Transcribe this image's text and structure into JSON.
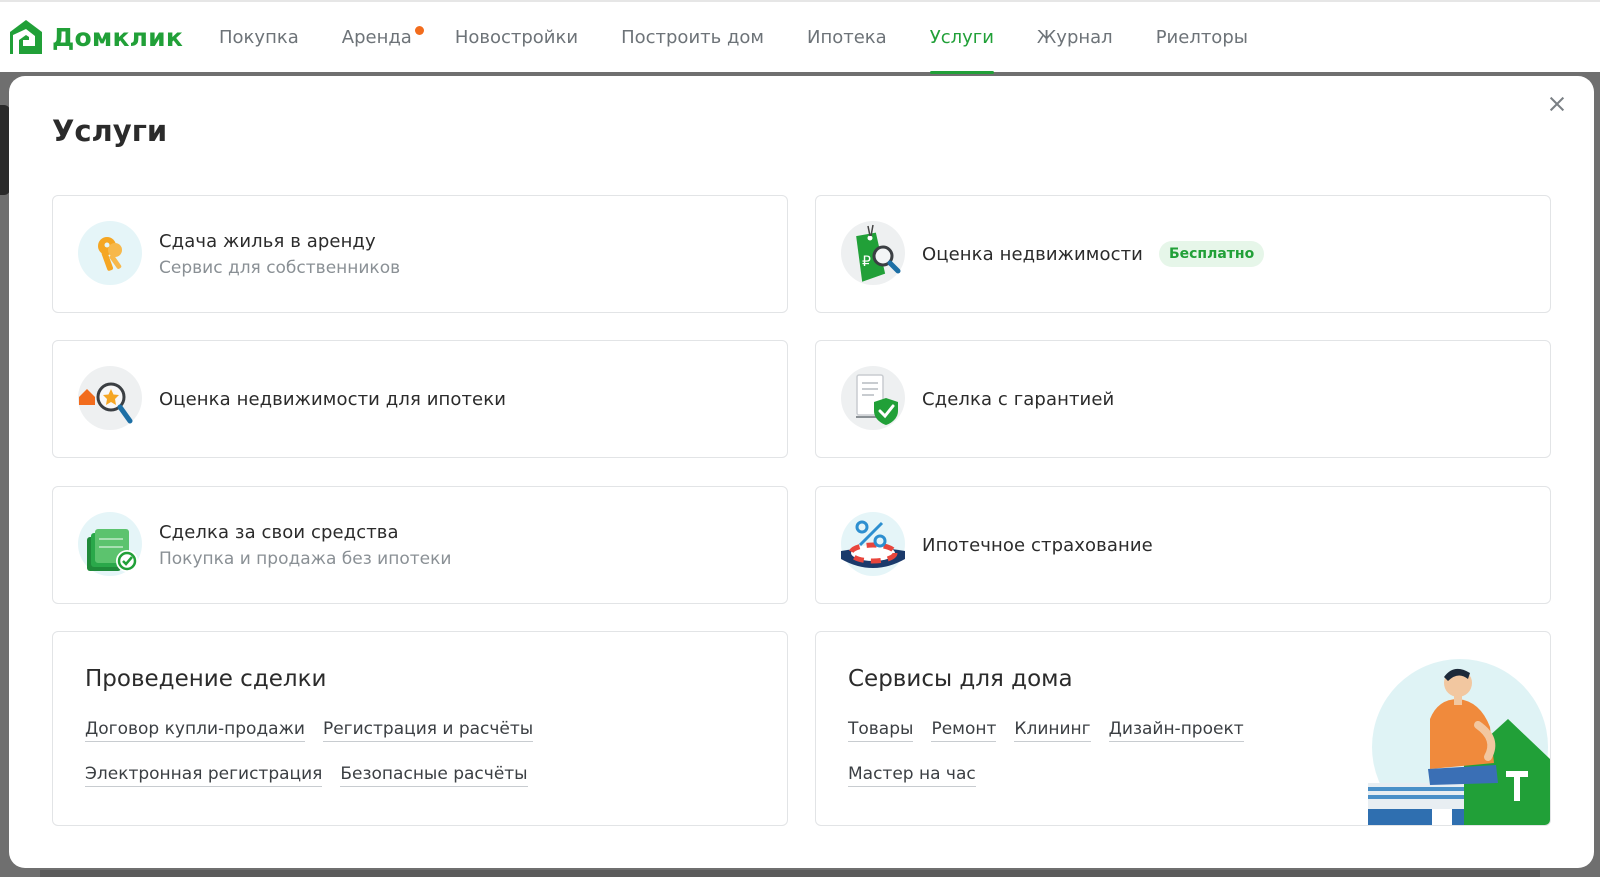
{
  "brand": {
    "name": "Домклик",
    "color": "#21a038",
    "icon": "domclick-logo-icon"
  },
  "nav": {
    "items": [
      {
        "label": "Покупка",
        "active": false,
        "dot": false
      },
      {
        "label": "Аренда",
        "active": false,
        "dot": true
      },
      {
        "label": "Новостройки",
        "active": false,
        "dot": false
      },
      {
        "label": "Построить дом",
        "active": false,
        "dot": false
      },
      {
        "label": "Ипотека",
        "active": false,
        "dot": false
      },
      {
        "label": "Услуги",
        "active": true,
        "dot": false
      },
      {
        "label": "Журнал",
        "active": false,
        "dot": false
      },
      {
        "label": "Риелторы",
        "active": false,
        "dot": false
      }
    ]
  },
  "modal": {
    "title": "Услуги",
    "cards": {
      "rent": {
        "title": "Сдача жилья в аренду",
        "subtitle": "Сервис для собственников",
        "icon": "keys-icon"
      },
      "valuation": {
        "title": "Оценка недвижимости",
        "badge": "Бесплатно",
        "icon": "price-tag-search-icon"
      },
      "mortgage_valuation": {
        "title": "Оценка недвижимости для ипотеки",
        "icon": "house-magnifier-icon"
      },
      "guaranteed_deal": {
        "title": "Сделка с гарантией",
        "icon": "document-shield-icon"
      },
      "own_funds": {
        "title": "Сделка за свои средства",
        "subtitle": "Покупка и продажа без ипотеки",
        "icon": "money-check-icon"
      },
      "insurance": {
        "title": "Ипотечное страхование",
        "icon": "percent-lifebuoy-icon"
      }
    },
    "deal": {
      "title": "Проведение сделки",
      "links": [
        "Договор купли-продажи",
        "Регистрация и расчёты",
        "Электронная регистрация",
        "Безопасные расчёты"
      ]
    },
    "home": {
      "title": "Сервисы для дома",
      "links": [
        "Товары",
        "Ремонт",
        "Клининг",
        "Дизайн-проект",
        "Мастер на час"
      ]
    }
  }
}
